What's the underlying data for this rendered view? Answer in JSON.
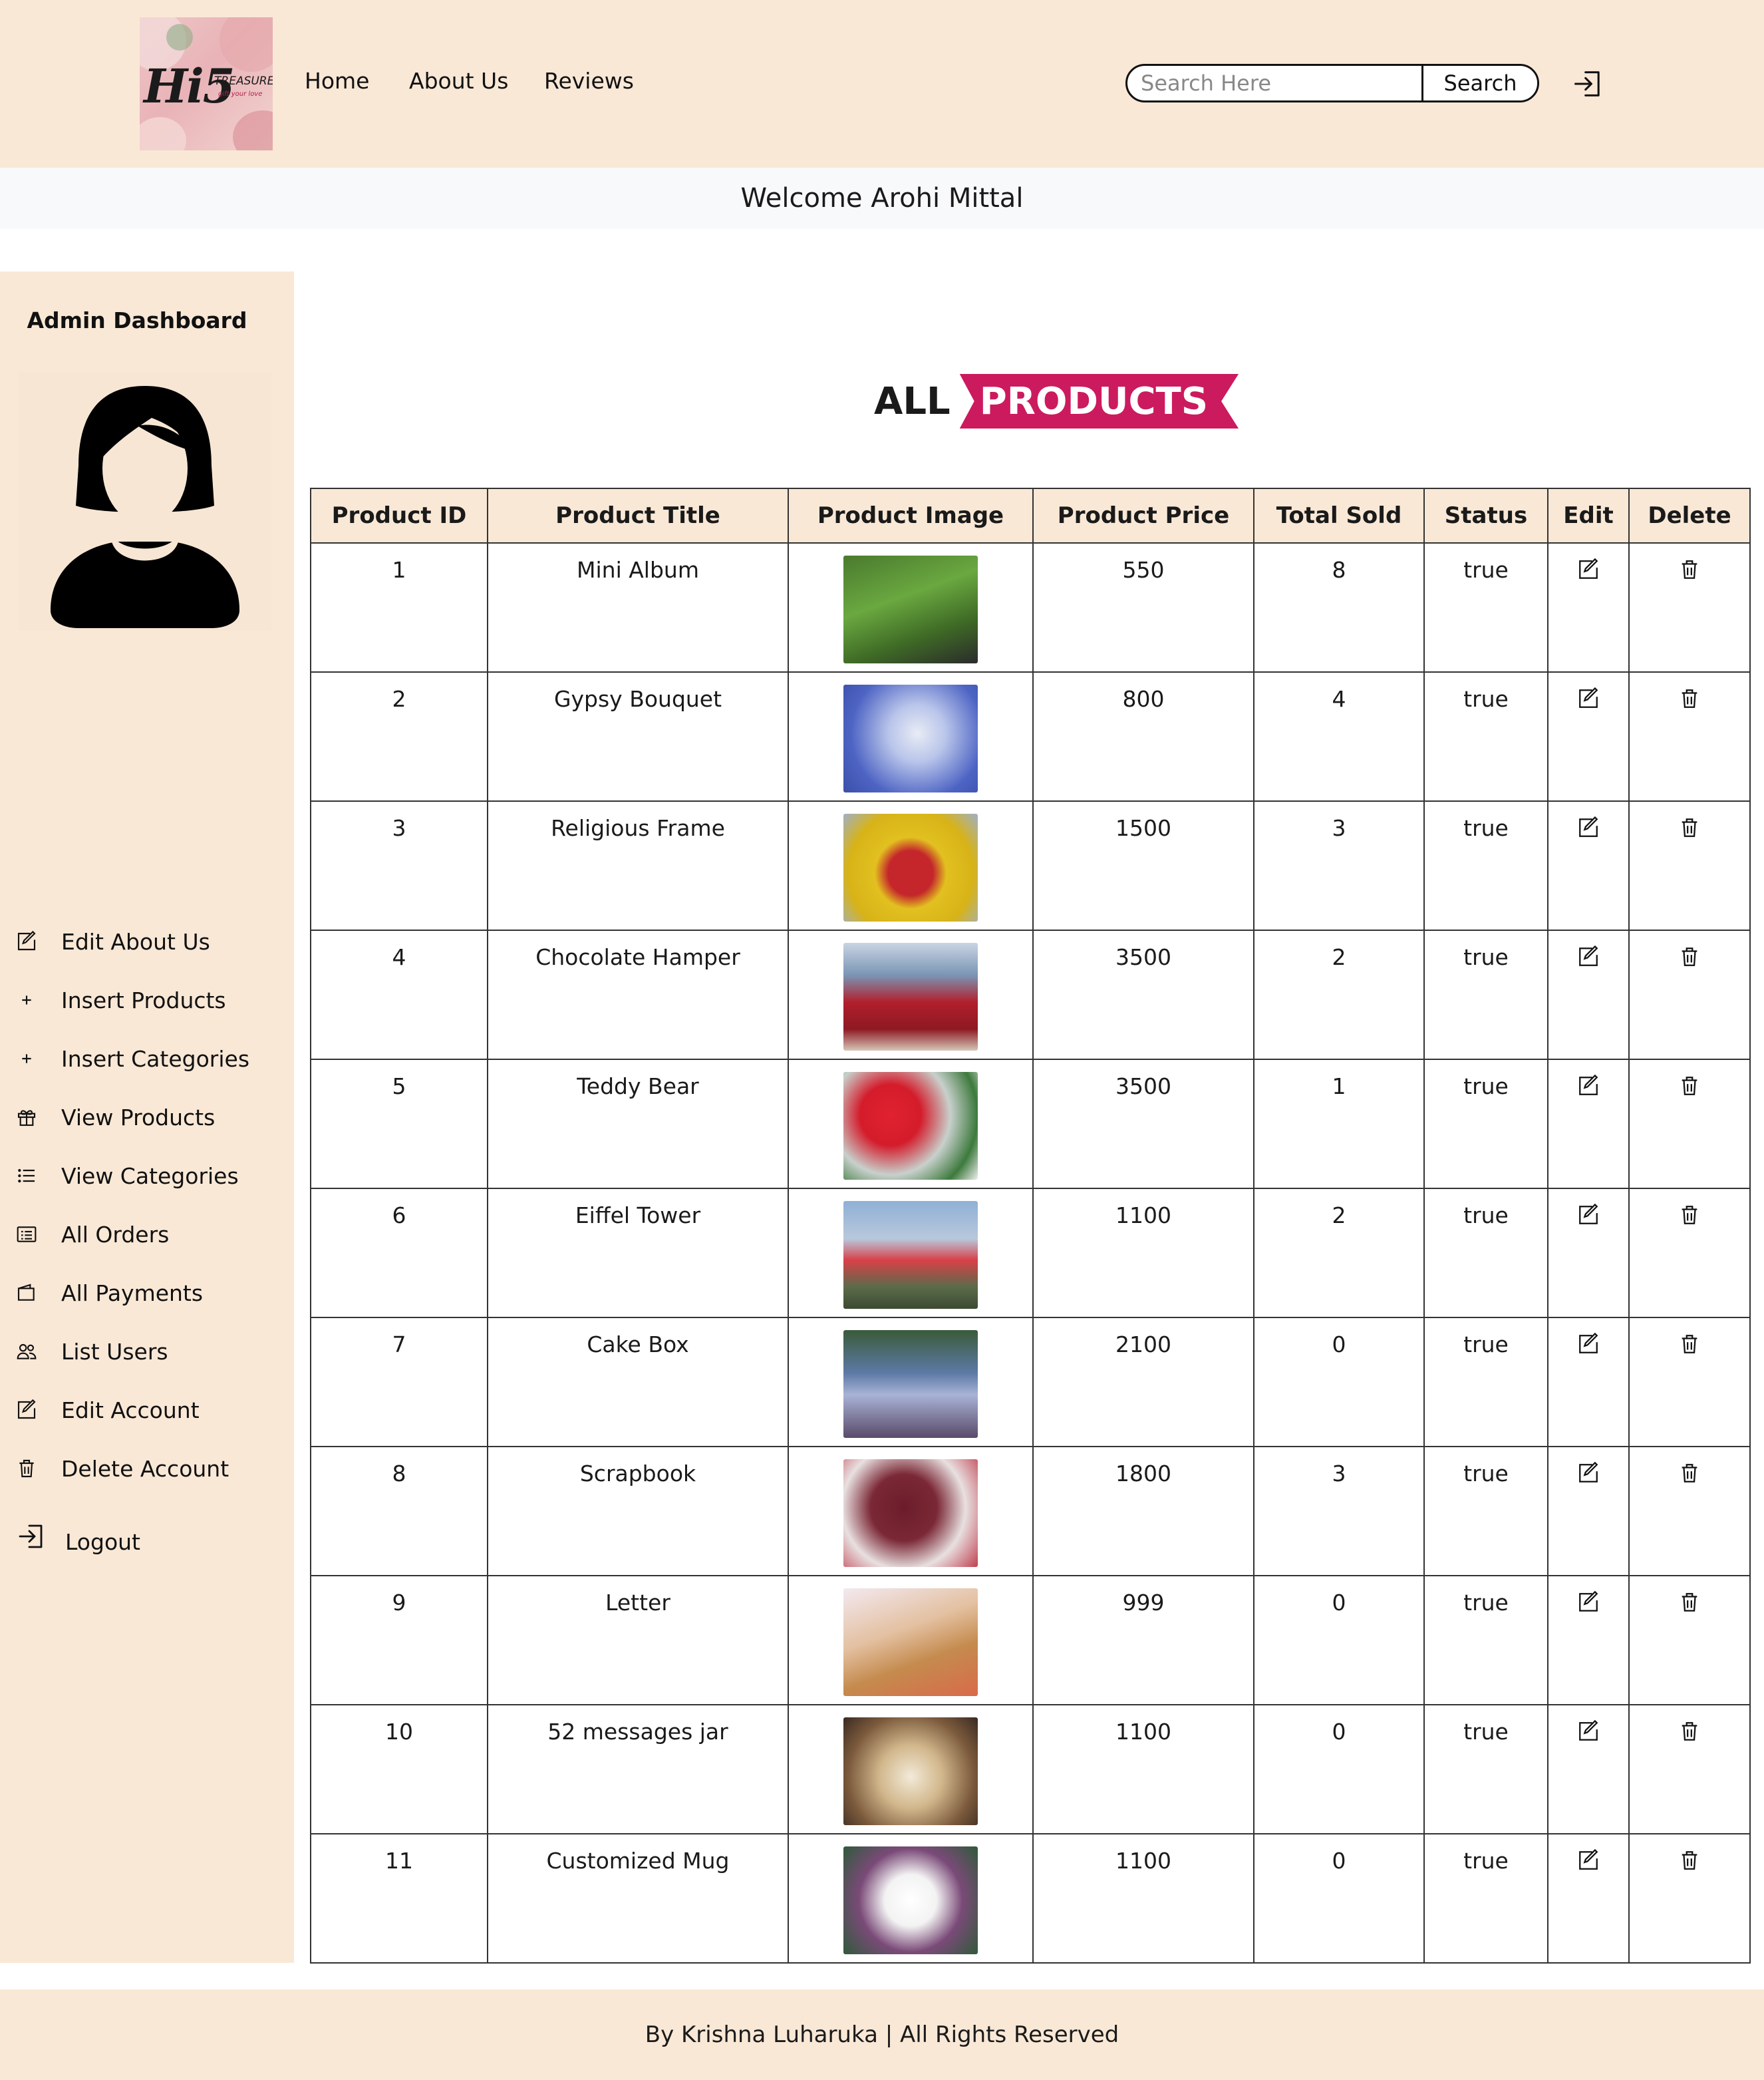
{
  "navbar": {
    "logo": {
      "brand": "Hi5",
      "sub": "TREASURES",
      "tagline": "gift your love"
    },
    "links": [
      "Home",
      "About Us",
      "Reviews"
    ],
    "search": {
      "placeholder": "Search Here",
      "value": "",
      "button_label": "Search"
    },
    "login_icon": "login-icon"
  },
  "welcome": {
    "text": "Welcome Arohi Mittal"
  },
  "sidebar": {
    "title": "Admin Dashboard",
    "avatar_icon": "user-avatar-icon",
    "items": [
      {
        "label": "Edit About Us",
        "icon": "edit-icon"
      },
      {
        "label": "Insert Products",
        "icon": "plus-icon"
      },
      {
        "label": "Insert Categories",
        "icon": "plus-icon"
      },
      {
        "label": "View Products",
        "icon": "gift-icon"
      },
      {
        "label": "View Categories",
        "icon": "list-icon"
      },
      {
        "label": "All Orders",
        "icon": "orders-icon"
      },
      {
        "label": "All Payments",
        "icon": "wallet-icon"
      },
      {
        "label": "List Users",
        "icon": "users-icon"
      },
      {
        "label": "Edit Account",
        "icon": "edit-icon"
      },
      {
        "label": "Delete Account",
        "icon": "trash-icon"
      },
      {
        "label": "Logout",
        "icon": "logout-icon"
      }
    ]
  },
  "main": {
    "title_part1": "ALL",
    "title_part2": "PRODUCTS",
    "table": {
      "headers": [
        "Product ID",
        "Product Title",
        "Product Image",
        "Product Price",
        "Total Sold",
        "Status",
        "Edit",
        "Delete"
      ],
      "rows": [
        {
          "id": "1",
          "title": "Mini Album",
          "image": "mini-album-image",
          "price": "550",
          "sold": "8",
          "status": "true"
        },
        {
          "id": "2",
          "title": "Gypsy Bouquet",
          "image": "gypsy-bouquet-image",
          "price": "800",
          "sold": "4",
          "status": "true"
        },
        {
          "id": "3",
          "title": "Religious Frame",
          "image": "religious-frame-image",
          "price": "1500",
          "sold": "3",
          "status": "true"
        },
        {
          "id": "4",
          "title": "Chocolate Hamper",
          "image": "chocolate-hamper-image",
          "price": "3500",
          "sold": "2",
          "status": "true"
        },
        {
          "id": "5",
          "title": "Teddy Bear",
          "image": "teddy-bear-image",
          "price": "3500",
          "sold": "1",
          "status": "true"
        },
        {
          "id": "6",
          "title": "Eiffel Tower",
          "image": "eiffel-tower-image",
          "price": "1100",
          "sold": "2",
          "status": "true"
        },
        {
          "id": "7",
          "title": "Cake Box",
          "image": "cake-box-image",
          "price": "2100",
          "sold": "0",
          "status": "true"
        },
        {
          "id": "8",
          "title": "Scrapbook",
          "image": "scrapbook-image",
          "price": "1800",
          "sold": "3",
          "status": "true"
        },
        {
          "id": "9",
          "title": "Letter",
          "image": "letter-image",
          "price": "999",
          "sold": "0",
          "status": "true"
        },
        {
          "id": "10",
          "title": "52 messages jar",
          "image": "messages-jar-image",
          "price": "1100",
          "sold": "0",
          "status": "true"
        },
        {
          "id": "11",
          "title": "Customized Mug",
          "image": "customized-mug-image",
          "price": "1100",
          "sold": "0",
          "status": "true"
        }
      ]
    }
  },
  "footer": {
    "text": "By Krishna Luharuka | All Rights Reserved"
  },
  "colors": {
    "cream": "#f9e8d6",
    "accent": "#cc1a5e",
    "welcome_bg": "#f8f9fa"
  }
}
